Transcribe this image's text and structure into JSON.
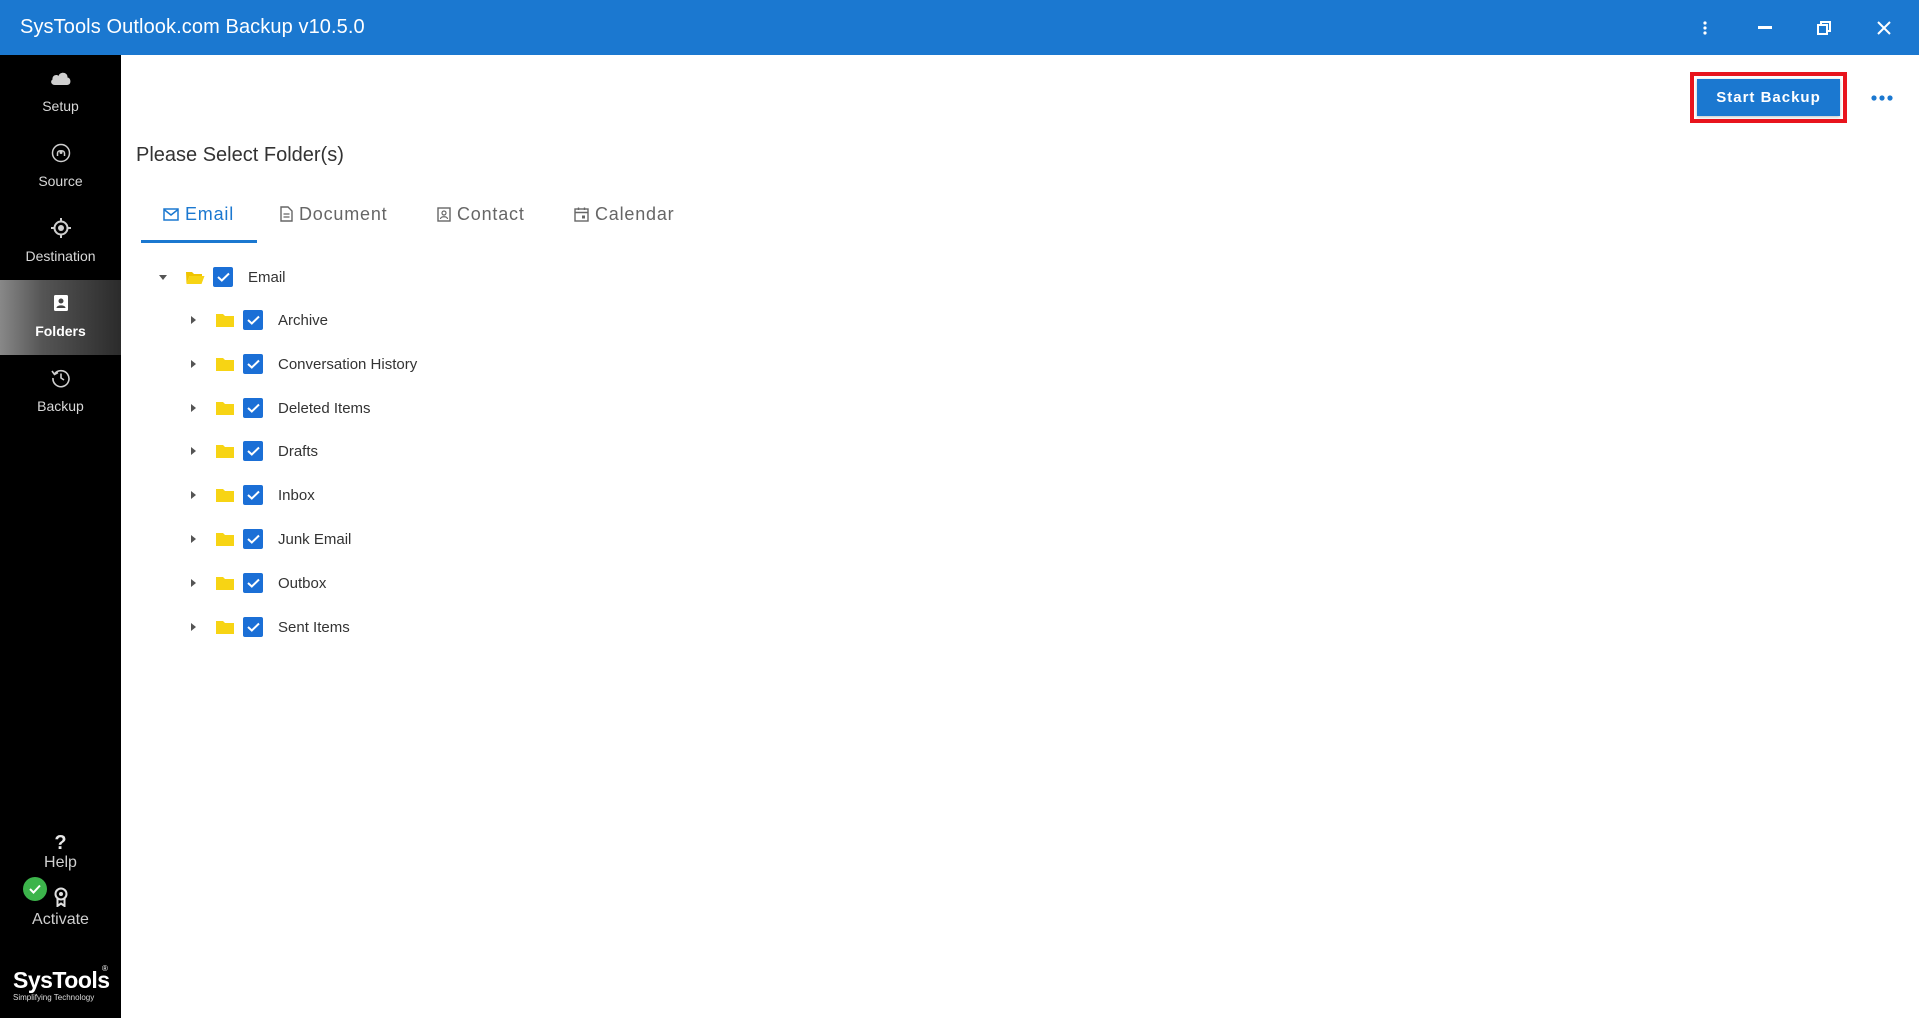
{
  "titlebar": {
    "title": "SysTools Outlook.com Backup v10.5.0"
  },
  "sidebar": {
    "items": [
      {
        "label": "Setup",
        "icon": "cloud-icon"
      },
      {
        "label": "Source",
        "icon": "source-icon"
      },
      {
        "label": "Destination",
        "icon": "destination-icon"
      },
      {
        "label": "Folders",
        "icon": "folders-icon",
        "active": true
      },
      {
        "label": "Backup",
        "icon": "history-icon"
      }
    ],
    "help": {
      "glyph": "?",
      "label": "Help"
    },
    "activate": {
      "label": "Activate"
    },
    "logo": {
      "brand": "SysTools",
      "tagline": "Simplifying Technology",
      "reg": "®"
    }
  },
  "toolbar": {
    "start_backup_label": "Start Backup"
  },
  "page": {
    "title": "Please Select Folder(s)"
  },
  "tabs": [
    {
      "label": "Email",
      "icon": "mail-icon",
      "active": true
    },
    {
      "label": "Document",
      "icon": "document-icon"
    },
    {
      "label": "Contact",
      "icon": "contact-icon"
    },
    {
      "label": "Calendar",
      "icon": "calendar-icon"
    }
  ],
  "tree": {
    "root": {
      "name": "Email",
      "expanded": true,
      "checked": true
    },
    "children": [
      {
        "name": "Archive",
        "checked": true
      },
      {
        "name": "Conversation History",
        "checked": true
      },
      {
        "name": "Deleted Items",
        "checked": true
      },
      {
        "name": "Drafts",
        "checked": true
      },
      {
        "name": "Inbox",
        "checked": true
      },
      {
        "name": "Junk Email",
        "checked": true
      },
      {
        "name": "Outbox",
        "checked": true
      },
      {
        "name": "Sent Items",
        "checked": true
      }
    ]
  },
  "colors": {
    "accent": "#1b78d0",
    "checkbox": "#1b6fd6",
    "folder": "#f7d414",
    "highlight_frame": "#e8141d",
    "sidebar_bg": "#000000",
    "activated": "#3cb44b"
  }
}
